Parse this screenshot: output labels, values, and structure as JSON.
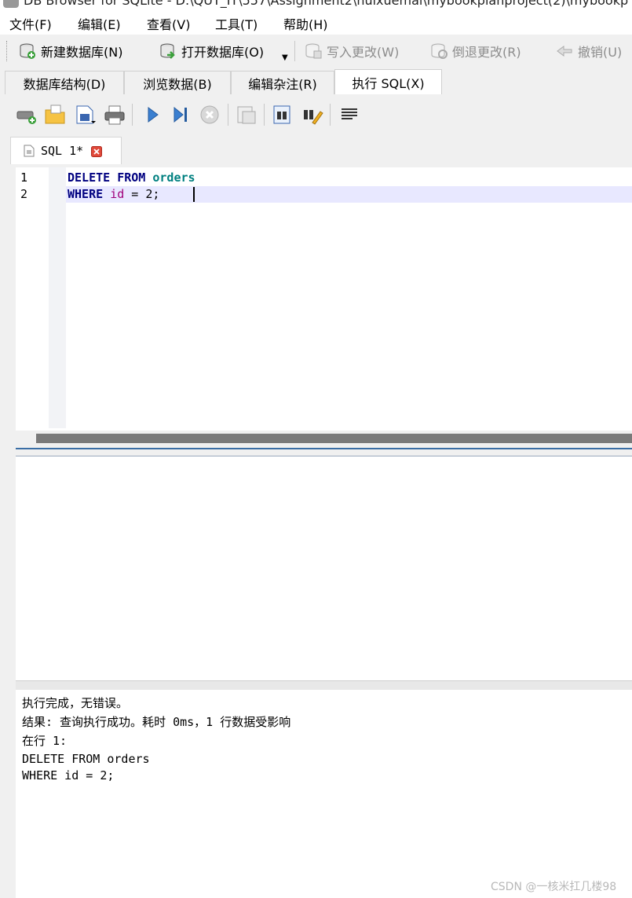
{
  "window": {
    "title": "DB Browser for SQLite - D:\\QUT_IT\\557\\Assignment2\\huixuemai\\mybookplanproject(2)\\mybookp"
  },
  "menubar": {
    "items": [
      "文件(F)",
      "编辑(E)",
      "查看(V)",
      "工具(T)",
      "帮助(H)"
    ]
  },
  "toolbar": {
    "new_db": "新建数据库(N)",
    "open_db": "打开数据库(O)",
    "write_changes": "写入更改(W)",
    "revert_changes": "倒退更改(R)",
    "undo": "撤销(U)"
  },
  "tabs": [
    "数据库结构(D)",
    "浏览数据(B)",
    "编辑杂注(R)",
    "执行 SQL(X)"
  ],
  "active_tab": "执行 SQL(X)",
  "sql_tab": {
    "label": "SQL 1*"
  },
  "editor": {
    "line_numbers": [
      "1",
      "2"
    ],
    "line1": {
      "kw1": "DELETE",
      "kw2": "FROM",
      "table": "orders"
    },
    "line2": {
      "kw1": "WHERE",
      "ident": "id",
      "rest": " = 2;"
    }
  },
  "messages": {
    "lines": [
      "执行完成，无错误。",
      "结果: 查询执行成功。耗时 0ms，1 行数据受影响",
      "在行 1:",
      "DELETE FROM orders",
      "WHERE id = 2;"
    ]
  },
  "watermark": "CSDN @一核米扛几楼98",
  "colors": {
    "keyword": "#000080",
    "table": "#008080",
    "identifier": "#a0007a",
    "current_line": "#e8e8ff",
    "close_tab": "#e0493a"
  }
}
